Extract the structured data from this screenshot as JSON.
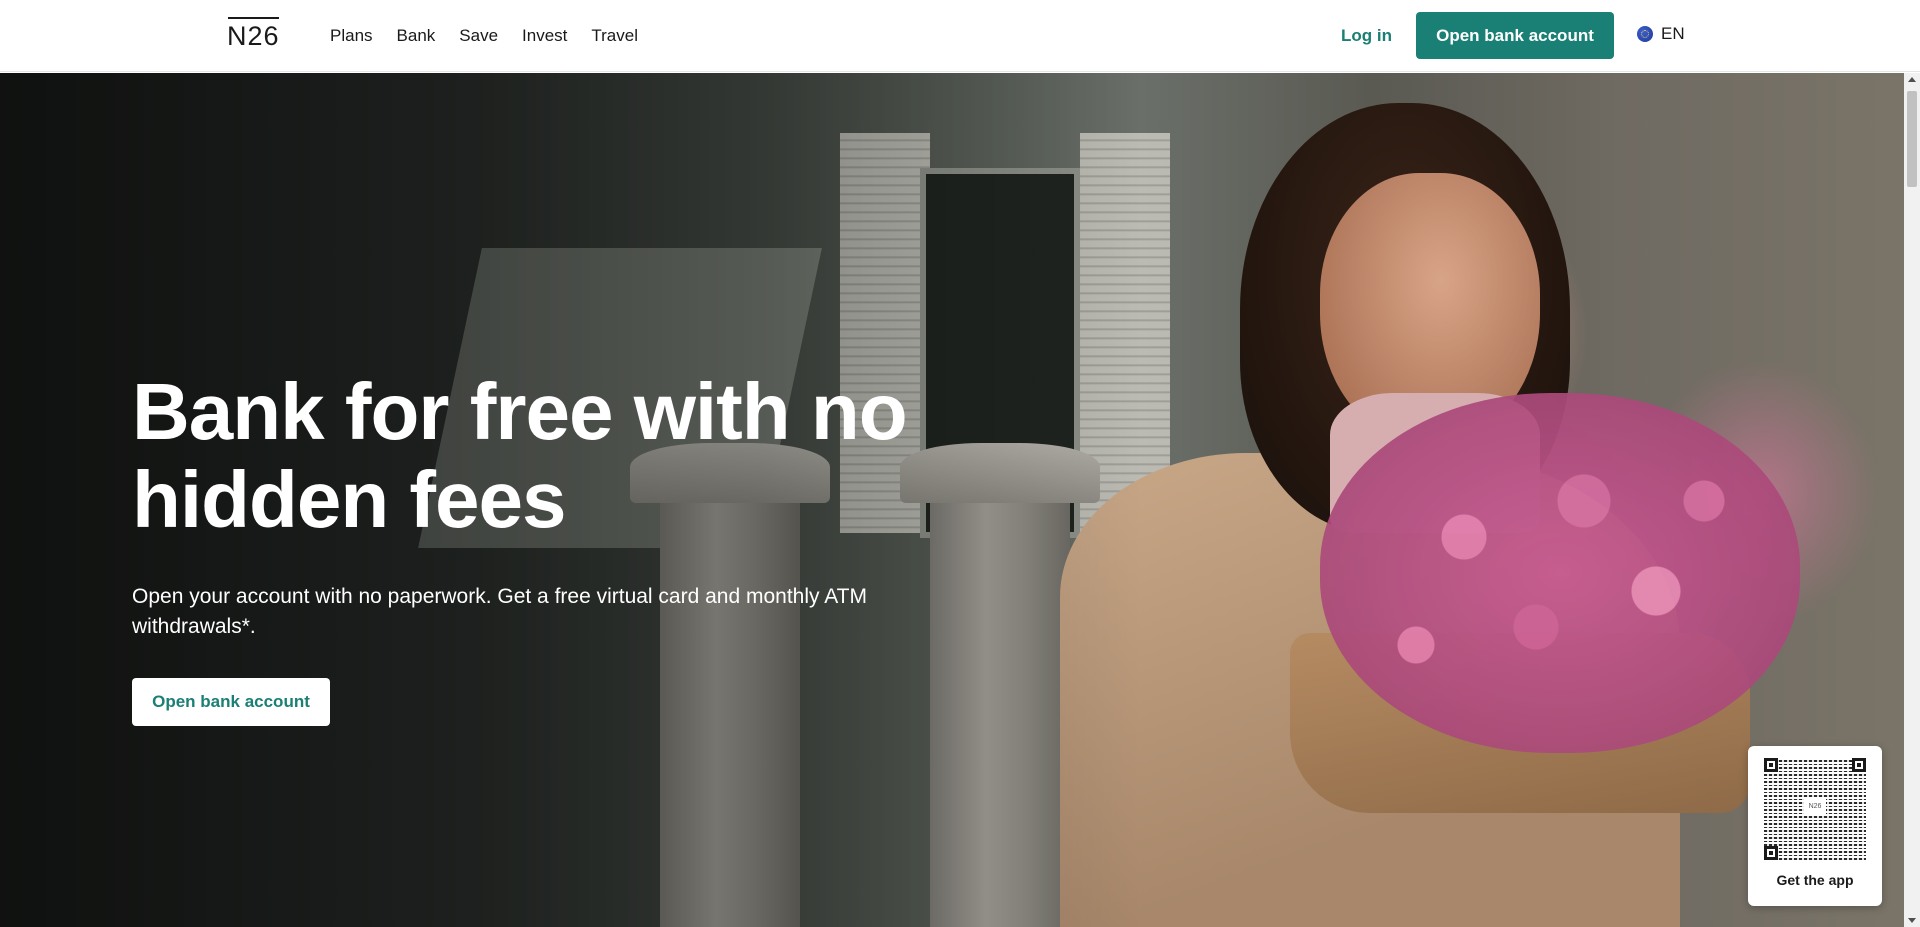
{
  "header": {
    "logo": "N26",
    "nav": [
      {
        "label": "Plans"
      },
      {
        "label": "Bank"
      },
      {
        "label": "Save"
      },
      {
        "label": "Invest"
      },
      {
        "label": "Travel"
      }
    ],
    "login_label": "Log in",
    "cta_label": "Open bank account",
    "language": "EN",
    "language_icon": "globe-icon"
  },
  "hero": {
    "title": "Bank for free with no hidden fees",
    "subtitle": "Open your account with no paperwork. Get a free virtual card and monthly ATM withdrawals*.",
    "cta_label": "Open bank account"
  },
  "qr_widget": {
    "label": "Get the app",
    "center_text": "N26"
  },
  "colors": {
    "brand": "#1a7f74",
    "text": "#1a1a1a",
    "hero_text": "#ffffff"
  }
}
